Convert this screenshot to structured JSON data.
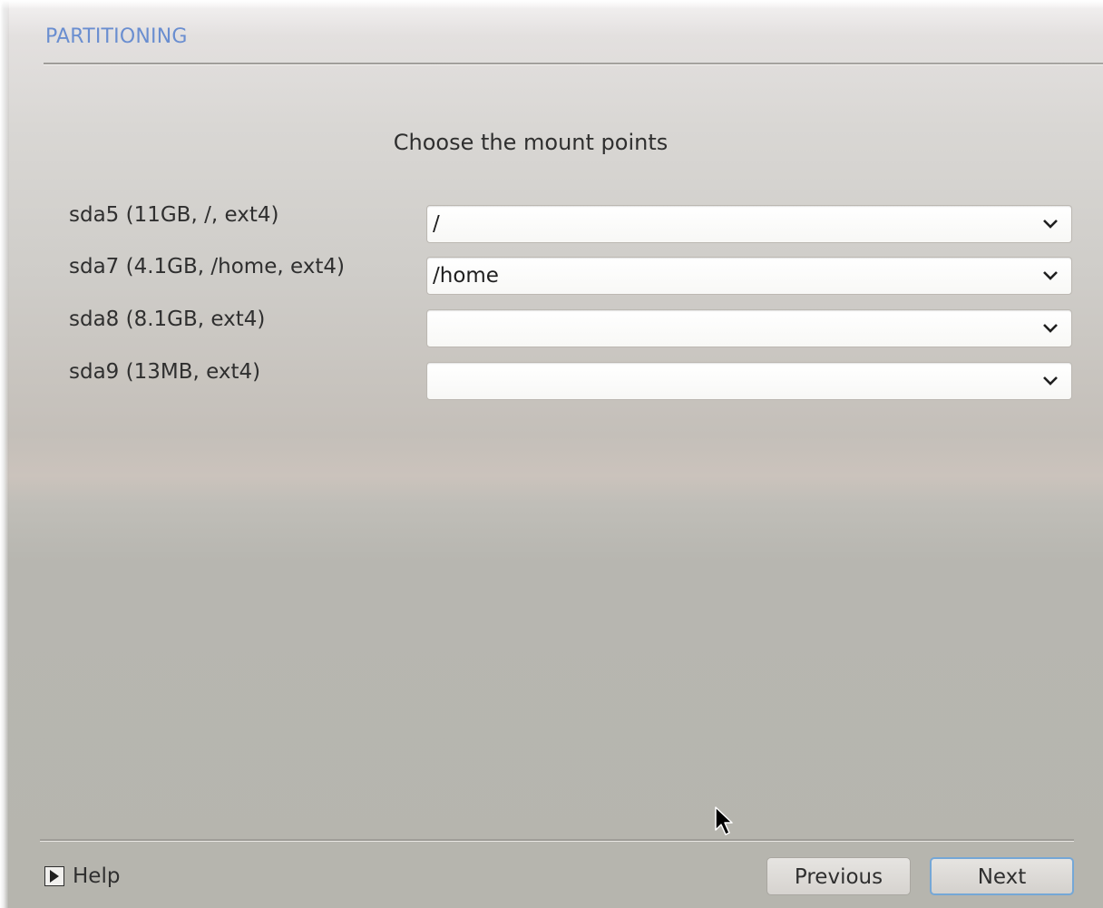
{
  "header": {
    "title": "PARTITIONING"
  },
  "main": {
    "subtitle": "Choose the mount points",
    "partitions": [
      {
        "label": "sda5 (11GB, /, ext4)",
        "mount_point": "/"
      },
      {
        "label": "sda7 (4.1GB, /home, ext4)",
        "mount_point": "/home"
      },
      {
        "label": "sda8 (8.1GB, ext4)",
        "mount_point": ""
      },
      {
        "label": "sda9 (13MB, ext4)",
        "mount_point": ""
      }
    ]
  },
  "footer": {
    "help_label": "Help",
    "help_icon": "disclosure-triangle-icon",
    "previous_label": "Previous",
    "next_label": "Next"
  },
  "colors": {
    "title": "#6a8ed0",
    "default_button_border": "#75a7d6",
    "background": "#d4d2ce"
  }
}
